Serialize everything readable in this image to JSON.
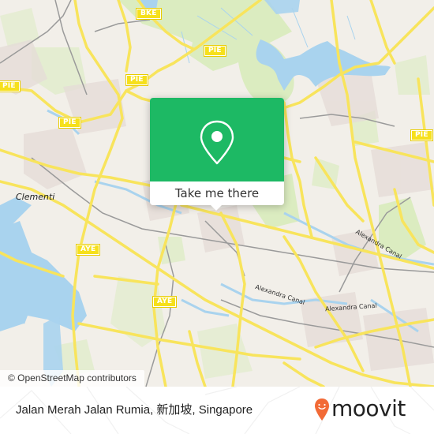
{
  "map": {
    "shields": [
      {
        "id": "bke-top",
        "label": "BKE"
      },
      {
        "id": "pie-1",
        "label": "PIE"
      },
      {
        "id": "pie-2",
        "label": "PIE"
      },
      {
        "id": "pie-3",
        "label": "PIE"
      },
      {
        "id": "pie-4",
        "label": "PIE"
      },
      {
        "id": "pie-5",
        "label": "PIE"
      },
      {
        "id": "aye-1",
        "label": "AYE"
      },
      {
        "id": "aye-2",
        "label": "AYE"
      }
    ],
    "places": {
      "clementi": "Clementi"
    },
    "canals": {
      "canal_1": "Alexandra Canal",
      "canal_2": "Alexandra Canal",
      "canal_3": "Alexandra Canal"
    },
    "attribution": "© OpenStreetMap contributors",
    "colors": {
      "land": "#f2efe9",
      "water": "#a9d3ee",
      "park": "#d6e9b4",
      "motorway": "#f8e45c",
      "rail": "#999999"
    }
  },
  "popup": {
    "icon": "location-pin-icon",
    "button_label": "Take me there",
    "accent_color": "#1db964"
  },
  "footer": {
    "title": "Jalan Merah Jalan Rumia, 新加坡, Singapore",
    "logo_text": "moovit",
    "logo_color": "#f26a36"
  }
}
